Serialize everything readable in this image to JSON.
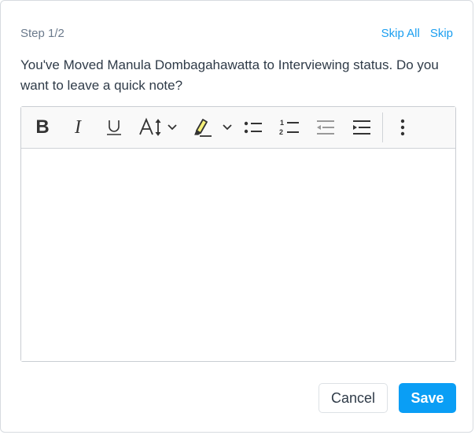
{
  "header": {
    "step": "Step 1/2",
    "skip_all": "Skip All",
    "skip": "Skip"
  },
  "message": "You've Moved Manula Dombagahawatta to Interviewing status. Do you want to leave a quick note?",
  "toolbar": {
    "items": [
      {
        "icon": "bold-icon",
        "glyph": "B"
      },
      {
        "icon": "italic-icon",
        "glyph": "I"
      },
      {
        "icon": "underline-icon",
        "glyph": "U"
      },
      {
        "icon": "font-size-icon",
        "glyph": "AI"
      },
      {
        "icon": "highlight-icon"
      },
      {
        "icon": "bulleted-list-icon"
      },
      {
        "icon": "numbered-list-icon"
      },
      {
        "icon": "outdent-icon"
      },
      {
        "icon": "indent-icon"
      },
      {
        "icon": "more-options-icon"
      }
    ],
    "highlight_color": "#f5f07a"
  },
  "editor": {
    "content": ""
  },
  "footer": {
    "cancel": "Cancel",
    "save": "Save"
  },
  "colors": {
    "accent": "#0a9ef5",
    "link": "#1a9ef0"
  }
}
